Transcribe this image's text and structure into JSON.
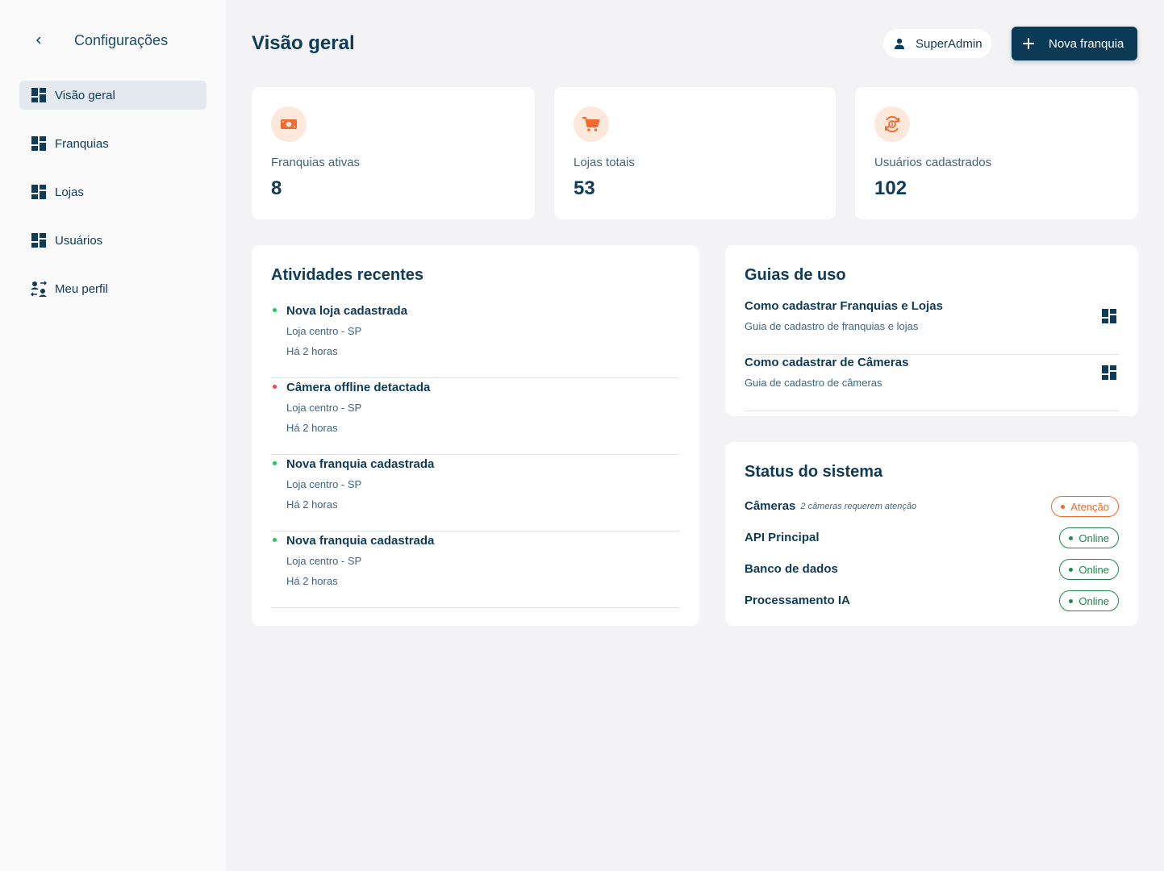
{
  "sidebar": {
    "title": "Configurações",
    "items": [
      {
        "label": "Visão geral",
        "icon": "dashboard-icon"
      },
      {
        "label": "Franquias",
        "icon": "dashboard-icon"
      },
      {
        "label": "Lojas",
        "icon": "dashboard-icon"
      },
      {
        "label": "Usuários",
        "icon": "dashboard-icon"
      },
      {
        "label": "Meu perfil",
        "icon": "profile-switch-icon"
      }
    ]
  },
  "header": {
    "title": "Visão geral",
    "user": "SuperAdmin",
    "new_button": "Nova franquia"
  },
  "stats": [
    {
      "label": "Franquias ativas",
      "value": "8",
      "icon": "money-icon"
    },
    {
      "label": "Lojas totais",
      "value": "53",
      "icon": "cart-icon"
    },
    {
      "label": "Usuários cadastrados",
      "value": "102",
      "icon": "currency-sync-icon"
    }
  ],
  "activities": {
    "title": "Atividades recentes",
    "items": [
      {
        "title": "Nova loja cadastrada",
        "subtitle": "Loja centro - SP",
        "time": "Há 2 horas",
        "status_color": "#22c55e"
      },
      {
        "title": "Câmera offline detactada",
        "subtitle": "Loja centro - SP",
        "time": "Há 2 horas",
        "status_color": "#ef4444"
      },
      {
        "title": "Nova franquia cadastrada",
        "subtitle": "Loja centro - SP",
        "time": "Há 2 horas",
        "status_color": "#22c55e"
      },
      {
        "title": "Nova franquia cadastrada",
        "subtitle": "Loja centro - SP",
        "time": "Há 2 horas",
        "status_color": "#22c55e"
      }
    ]
  },
  "guides": {
    "title": "Guias de uso",
    "items": [
      {
        "title": "Como cadastrar Franquias e Lojas",
        "subtitle": "Guia de cadastro de franquias e lojas"
      },
      {
        "title": "Como cadastrar de Câmeras",
        "subtitle": "Guia de cadastro de câmeras"
      }
    ]
  },
  "system_status": {
    "title": "Status do sistema",
    "items": [
      {
        "name": "Câmeras",
        "note": "2 câmeras requerem atenção",
        "status": "Atenção",
        "kind": "warn"
      },
      {
        "name": "API Principal",
        "note": "",
        "status": "Online",
        "kind": "online"
      },
      {
        "name": "Banco de dados",
        "note": "",
        "status": "Online",
        "kind": "online"
      },
      {
        "name": "Processamento IA",
        "note": "",
        "status": "Online",
        "kind": "online"
      }
    ]
  },
  "colors": {
    "primary": "#0b3a57",
    "accent": "#f26a2e",
    "online": "#1c8a4c"
  }
}
